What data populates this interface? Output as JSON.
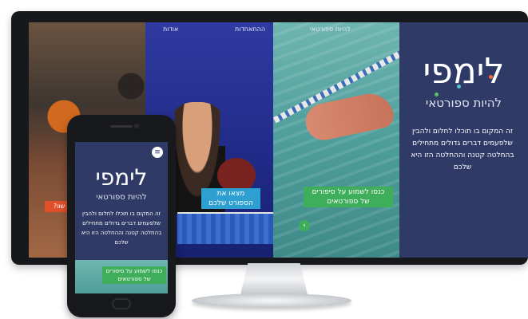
{
  "desktop": {
    "nav": {
      "about": "אודות",
      "register": "ההתאחדות",
      "become": "להיות ספורטאי"
    },
    "brand": {
      "logo": "לימפי",
      "subtitle": "להיות ספורטאי",
      "description": "זה המקום בו תוכלו לחלום ולהבין שלפעמים דברים גדולים מתחילים בהחלטה קטנה וההחלטה הזו היא שלכם"
    },
    "cta_swim": "כנסו לשמוע על סיפורים של ספורטאים",
    "cta_tennis": "מצאו את הספורט שלכם",
    "cta_basket": "שוו?",
    "arrow": "‹"
  },
  "phone": {
    "logo": "לימפי",
    "subtitle": "להיות ספורטאי",
    "description": "זה המקום בו תוכלו לחלום ולהבין שלפעמים דברים גדולים מתחילים בהחלטה קטנה וההחלטה הזו היא שלכם",
    "cta": "כנסו לשמוע על סיפורים של ספורטאים",
    "menu_icon": "≡"
  },
  "colors": {
    "brand_navy": "#2f3b66",
    "accent_green": "#3fae5b",
    "accent_blue": "#2d9fd0",
    "accent_orange": "#e0502a"
  }
}
